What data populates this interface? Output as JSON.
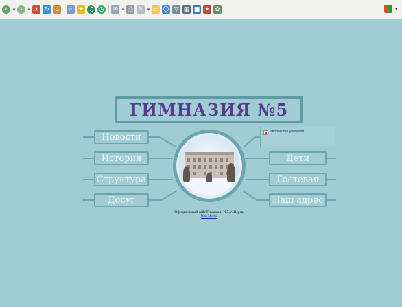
{
  "site": {
    "title": "ГИМНАЗИЯ №5",
    "footer_line1": "Официальный сайт Гимназии №5, г. Пермь",
    "footer_line2": "Web Master"
  },
  "nav_left": [
    {
      "label": "Новости"
    },
    {
      "label": "История"
    },
    {
      "label": "Структура"
    },
    {
      "label": "Досуг"
    }
  ],
  "nav_right": [
    {
      "label": "Дети"
    },
    {
      "label": "Гостевая"
    },
    {
      "label": "Наш адрес"
    }
  ],
  "panel": {
    "item_label": "Творчество учителей"
  },
  "colors": {
    "page_background": "#a0ccd4",
    "frame_accent": "#6ea4ad",
    "title_text": "#5a3a8e",
    "button_text": "#eef8fa"
  },
  "toolbar": {
    "icons": [
      "back-icon",
      "forward-icon",
      "stop-icon",
      "refresh-icon",
      "home-icon",
      "search-icon",
      "favorites-icon",
      "media-icon",
      "history-icon",
      "mail-icon",
      "print-icon",
      "edit-icon",
      "folder-icon",
      "messenger-icon",
      "filter-icon",
      "tools-icon",
      "addon-icon",
      "spy-icon"
    ],
    "right_icons": [
      "windows-logo-icon"
    ]
  }
}
